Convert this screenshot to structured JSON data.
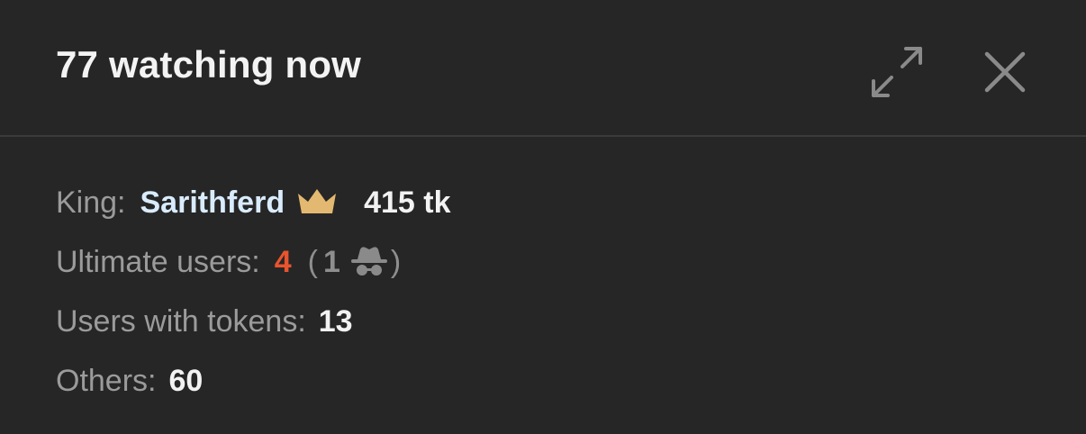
{
  "header": {
    "title": "77 watching now",
    "expand_icon": "expand-arrows-icon",
    "close_icon": "close-x-icon"
  },
  "stats": {
    "king": {
      "label": "King:",
      "username": "Sarithferd",
      "icon": "crown-icon",
      "amount": "415 tk"
    },
    "ultimate_users": {
      "label": "Ultimate users:",
      "count": "4",
      "paren_open": "(",
      "anonymous_count": "1",
      "anonymous_icon": "incognito-spy-icon",
      "paren_close": ")"
    },
    "users_with_tokens": {
      "label": "Users with tokens:",
      "count": "13"
    },
    "others": {
      "label": "Others:",
      "count": "60"
    }
  },
  "colors": {
    "background": "#262626",
    "divider": "#3b3b3b",
    "title": "#f3f3f3",
    "label": "#9b9b9b",
    "username": "#d9ecff",
    "crown": "#e3b870",
    "ultimate_accent": "#e8542e",
    "value": "#f2f2f2",
    "icon": "#8a8a8a"
  }
}
